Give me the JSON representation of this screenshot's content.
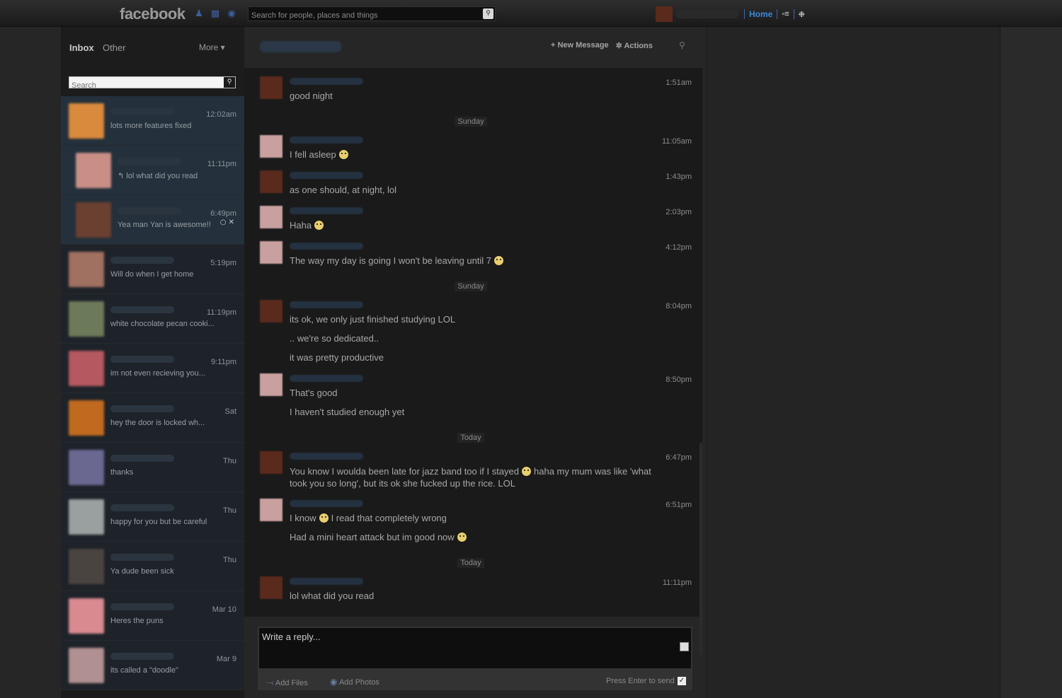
{
  "topbar": {
    "logo": "facebook",
    "search_placeholder": "Search for people, places and things",
    "home_label": "Home"
  },
  "inbox": {
    "tab_inbox": "Inbox",
    "tab_other": "Other",
    "more_label": "More ▾",
    "search_placeholder": "Search",
    "threads": [
      {
        "time": "12:02am",
        "snippet": "lots more features fixed",
        "color": "#d98a3d"
      },
      {
        "time": "11:11pm",
        "snippet": "↰ lol what did you read",
        "color": "#c98f86"
      },
      {
        "time": "6:49pm",
        "snippet": "Yea man Yan is awesome!!",
        "color": "#6a4030"
      },
      {
        "time": "5:19pm",
        "snippet": "Will do when I get home",
        "color": "#a07060"
      },
      {
        "time": "11:19pm",
        "snippet": "white chocolate pecan cooki...",
        "color": "#6d7a5a"
      },
      {
        "time": "9:11pm",
        "snippet": "im not even recieving you...",
        "color": "#b55860"
      },
      {
        "time": "Sat",
        "snippet": "hey the door is locked wh...",
        "color": "#c06a20"
      },
      {
        "time": "Thu",
        "snippet": "thanks",
        "color": "#6a6890"
      },
      {
        "time": "Thu",
        "snippet": "happy for you but be careful",
        "color": "#9aa0a0"
      },
      {
        "time": "Thu",
        "snippet": "Ya dude been sick",
        "color": "#4a4440"
      },
      {
        "time": "Mar 10",
        "snippet": "Heres the puns",
        "color": "#d98a90"
      },
      {
        "time": "Mar 9",
        "snippet": "its called a \"doodle\"",
        "color": "#b09090"
      }
    ]
  },
  "conversation": {
    "new_message": "+ New Message",
    "actions": "✲ Actions",
    "dividers": [
      "Sunday",
      "Sunday",
      "Today",
      "Today"
    ],
    "messages": [
      {
        "time": "1:51am",
        "lines": [
          "good night"
        ]
      },
      {
        "time": "11:05am",
        "lines": [
          "I fell asleep"
        ]
      },
      {
        "time": "1:43pm",
        "lines": [
          "as one should, at night, lol"
        ]
      },
      {
        "time": "2:03pm",
        "lines": [
          "Haha"
        ]
      },
      {
        "time": "4:12pm",
        "lines": [
          "The way my day is going I won't be leaving until 7"
        ]
      },
      {
        "time": "8:04pm",
        "lines": [
          "its ok, we only just finished studying LOL",
          ".. we're so dedicated..",
          "it was pretty productive"
        ]
      },
      {
        "time": "8:50pm",
        "lines": [
          "That's good",
          "I haven't studied enough yet"
        ]
      },
      {
        "time": "6:47pm",
        "lines": [
          "You know I woulda been late for jazz band too if I stayed",
          "haha my mum was like 'what took you so long', but its ok she fucked up the rice. LOL"
        ]
      },
      {
        "time": "6:51pm",
        "lines": [
          "I know",
          "I read that completely wrong",
          "Had a mini heart attack but im good now"
        ]
      },
      {
        "time": "11:11pm",
        "lines": [
          "lol what did you read"
        ]
      }
    ],
    "composer": {
      "placeholder": "Write a reply...",
      "add_files": "Add Files",
      "add_photos": "Add Photos",
      "press_enter": "Press Enter to send"
    }
  }
}
